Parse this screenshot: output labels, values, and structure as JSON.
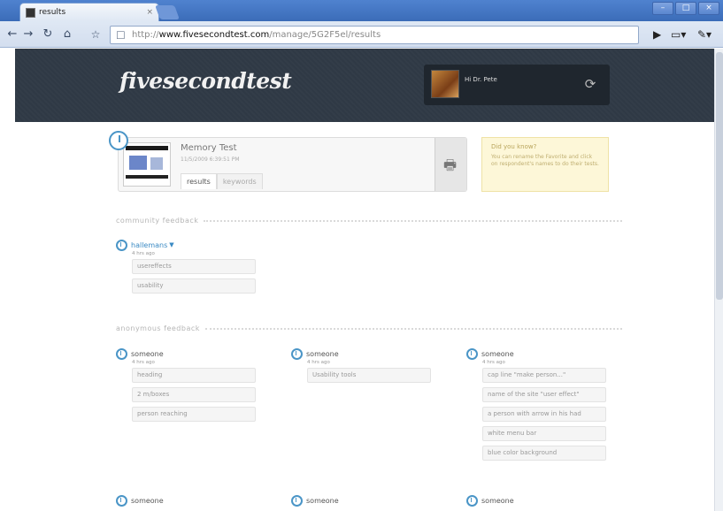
{
  "browser": {
    "tab_title": "results",
    "tab_close": "×",
    "url_prefix": "http://",
    "url_domain": "www.fivesecondtest.com",
    "url_path": "/manage/5G2F5el/results",
    "win_min": "–",
    "win_max": "□",
    "win_close": "×"
  },
  "site": {
    "logo": "fivesecondtest",
    "greeting": "Hi Dr. Pete"
  },
  "test": {
    "title": "Memory Test",
    "date": "11/5/2009 6:39:51 PM",
    "tabs": [
      "results",
      "keywords"
    ]
  },
  "tip": {
    "title": "Did you know?",
    "text": "You can rename the Favorite and click on respondent's names to do their tests."
  },
  "sections": {
    "community": "community feedback",
    "anonymous": "anonymous feedback"
  },
  "community_feedback": [
    {
      "name": "hallemans",
      "time": "4 hrs ago",
      "items": [
        "usereffects",
        "usability"
      ]
    }
  ],
  "anonymous_feedback": [
    {
      "name": "someone",
      "time": "4 hrs ago",
      "items": [
        "heading",
        "2 m/boxes",
        "person reaching"
      ]
    },
    {
      "name": "someone",
      "time": "4 hrs ago",
      "items": [
        "Usability tools"
      ]
    },
    {
      "name": "someone",
      "time": "4 hrs ago",
      "items": [
        "cap line \"make person...\"",
        "name of the site \"user effect\"",
        "a person with arrow in his had",
        "white menu bar",
        "blue color background"
      ]
    },
    {
      "name": "someone"
    },
    {
      "name": "someone"
    },
    {
      "name": "someone"
    }
  ],
  "colors": {
    "header_bg": "#2f3945",
    "accent": "#4a95c7",
    "tip_bg": "#fdf7d8"
  },
  "icons": [
    "back-icon",
    "forward-icon",
    "reload-icon",
    "home-icon",
    "bookmark-star-icon",
    "page-menu-icon",
    "wrench-icon",
    "clock-icon",
    "print-icon",
    "user-settings-icon"
  ]
}
